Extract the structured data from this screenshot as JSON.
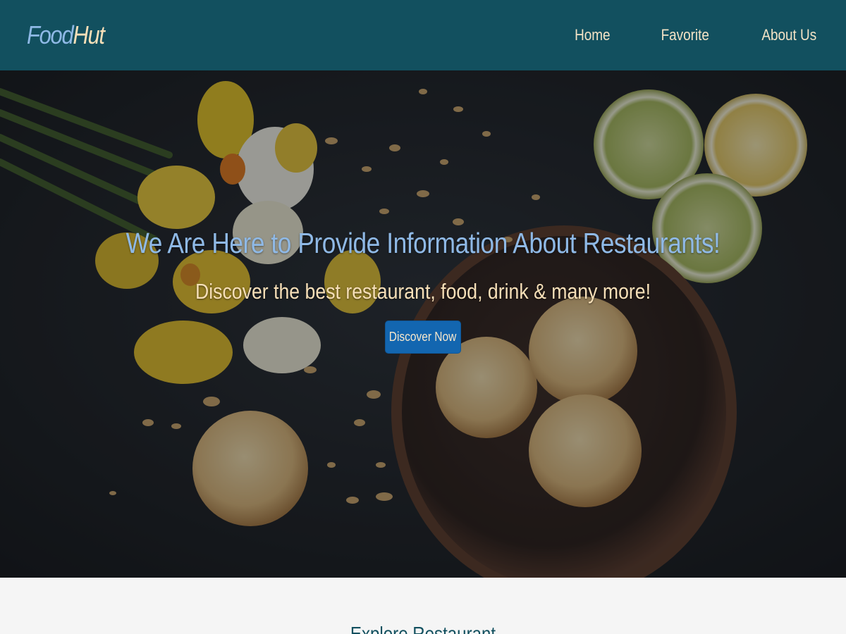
{
  "brand": {
    "part1": "Food",
    "part2": "Hut"
  },
  "nav": {
    "items": [
      {
        "label": "Home"
      },
      {
        "label": "Favorite"
      },
      {
        "label": "About Us"
      }
    ]
  },
  "hero": {
    "title": "We Are Here to Provide Information About Restaurants!",
    "subtitle": "Discover the best restaurant, food, drink & many more!",
    "cta_label": "Discover Now"
  },
  "explore": {
    "title": "Explore Restaurant"
  },
  "colors": {
    "header_bg": "#12505f",
    "brand_primary": "#8fb9e6",
    "brand_secondary": "#f6dfb8",
    "nav_text": "#f3e3c6",
    "cta_bg": "#1366b0",
    "page_bg": "#f5f5f5"
  }
}
